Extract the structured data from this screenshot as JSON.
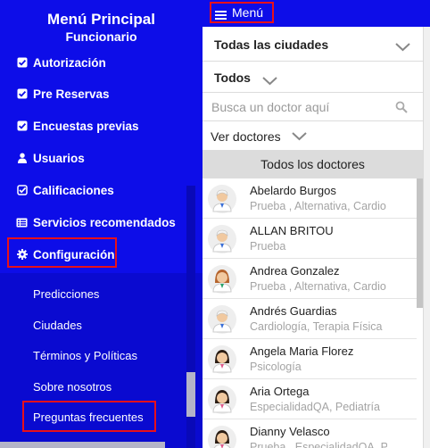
{
  "sidebar": {
    "title": "Menú Principal",
    "subtitle": "Funcionario",
    "items": [
      {
        "label": "Autorización",
        "icon": "check-square-icon"
      },
      {
        "label": "Pre Reservas",
        "icon": "check-square-icon"
      },
      {
        "label": "Encuestas previas",
        "icon": "check-square-icon"
      },
      {
        "label": "Usuarios",
        "icon": "user-icon"
      },
      {
        "label": "Calificaciones",
        "icon": "check-square-outline-icon"
      },
      {
        "label": "Servicios recomendados",
        "icon": "list-card-icon"
      },
      {
        "label": "Configuración",
        "icon": "gear-icon"
      }
    ],
    "submenu": [
      "Predicciones",
      "Ciudades",
      "Términos y Políticas",
      "Sobre nosotros",
      "Preguntas frecuentes"
    ]
  },
  "topbar": {
    "menu_label": "Menú",
    "menu_icon": "hamburger-icon"
  },
  "filters": {
    "city": "Todas las ciudades",
    "all": "Todos",
    "search_placeholder": "Busca un doctor aquí",
    "view": "Ver doctores"
  },
  "list_header": "Todos los doctores",
  "doctors": [
    {
      "name": "Abelardo Burgos",
      "specialty": "Prueba , Alternativa, Cardio",
      "avatar": "male-doctor-icon"
    },
    {
      "name": "ALLAN BRITOU",
      "specialty": "Prueba",
      "avatar": "male-doctor-icon"
    },
    {
      "name": "Andrea Gonzalez",
      "specialty": "Prueba , Alternativa, Cardio",
      "avatar": "female-doctor-icon"
    },
    {
      "name": "Andrés Guardias",
      "specialty": "Cardiología, Terapia Física",
      "avatar": "male-doctor-icon"
    },
    {
      "name": "Angela Maria Florez",
      "specialty": "Psicología",
      "avatar": "female-doctor-dark-icon"
    },
    {
      "name": "Aria Ortega",
      "specialty": "EspecialidadQA, Pediatría",
      "avatar": "female-doctor-dark-icon"
    },
    {
      "name": "Dianny Velasco",
      "specialty": "Prueba , EspecialidadQA, Pe",
      "avatar": "female-doctor-dark-icon"
    }
  ],
  "colors": {
    "sidebar_blue": "#0d0de8",
    "highlight_red": "#e8101a",
    "list_header_gray": "#dcdcdc"
  }
}
